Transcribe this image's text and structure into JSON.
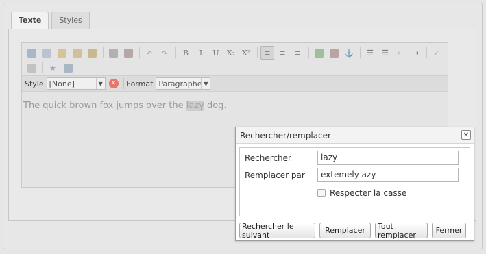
{
  "tabs": [
    {
      "label": "Texte",
      "active": true
    },
    {
      "label": "Styles",
      "active": false
    }
  ],
  "toolbar": {
    "row1": [
      {
        "name": "cut-icon",
        "glyph": "",
        "color": "#a8b8cc"
      },
      {
        "name": "copy-icon",
        "glyph": "",
        "color": "#b9c4d0"
      },
      {
        "name": "paste-icon",
        "glyph": "",
        "color": "#d7c39a"
      },
      {
        "name": "paste-text-icon",
        "glyph": "",
        "color": "#d2c09c"
      },
      {
        "name": "paste-word-icon",
        "glyph": "",
        "color": "#c9b98f"
      },
      {
        "sep": true
      },
      {
        "name": "link-icon",
        "glyph": "",
        "color": "#b1b1b1"
      },
      {
        "name": "unlink-icon",
        "glyph": "",
        "color": "#b7a6a6"
      },
      {
        "sep": true
      },
      {
        "name": "undo-icon",
        "glyph": "↶",
        "color": "#8fa3c1"
      },
      {
        "name": "redo-icon",
        "glyph": "↷",
        "color": "#8fa3c1"
      },
      {
        "sep": true
      },
      {
        "name": "bold-icon",
        "glyph": "B",
        "color": "#7c7c7c"
      },
      {
        "name": "italic-icon",
        "glyph": "I",
        "color": "#7c7c7c"
      },
      {
        "name": "underline-icon",
        "glyph": "U",
        "color": "#7c7c7c"
      },
      {
        "name": "subscript-icon",
        "glyph": "X₂",
        "color": "#7c7c7c"
      },
      {
        "name": "superscript-icon",
        "glyph": "X²",
        "color": "#7c7c7c"
      },
      {
        "sep": true
      },
      {
        "name": "align-left-icon",
        "glyph": "≡",
        "color": "#7c7c7c",
        "pressed": true
      },
      {
        "name": "align-center-icon",
        "glyph": "≡",
        "color": "#7c7c7c"
      },
      {
        "name": "align-right-icon",
        "glyph": "≡",
        "color": "#7c7c7c"
      },
      {
        "sep": true
      },
      {
        "name": "image-icon",
        "glyph": "",
        "color": "#9fbf9a"
      },
      {
        "name": "flash-icon",
        "glyph": "",
        "color": "#b9a3a3"
      },
      {
        "name": "anchor-icon",
        "glyph": "⚓",
        "color": "#7c7c7c"
      },
      {
        "sep": true
      },
      {
        "name": "bullet-list-icon",
        "glyph": "☰",
        "color": "#7c7c7c"
      },
      {
        "name": "numbered-list-icon",
        "glyph": "☰",
        "color": "#7c7c7c"
      },
      {
        "name": "outdent-icon",
        "glyph": "⇤",
        "color": "#7c7c7c"
      },
      {
        "name": "indent-icon",
        "glyph": "⇥",
        "color": "#7c7c7c"
      },
      {
        "sep": true
      },
      {
        "name": "spellcheck-icon",
        "glyph": "✓",
        "color": "#8fb3c8"
      }
    ],
    "row2": [
      {
        "name": "table-icon",
        "glyph": "",
        "color": "#c2c2c2"
      },
      {
        "sep": true
      },
      {
        "name": "star-icon",
        "glyph": "★",
        "color": "#8fa8c8"
      },
      {
        "name": "find-replace-icon",
        "glyph": "",
        "color": "#a9b6c6"
      }
    ]
  },
  "format_bar": {
    "style_label": "Style",
    "style_value": "[None]",
    "format_label": "Format",
    "format_value": "Paragraphe"
  },
  "content": {
    "before": "The quick brown fox jumps over the ",
    "highlighted": "lazy",
    "after": " dog."
  },
  "dialog": {
    "title": "Rechercher/remplacer",
    "close_glyph": "✕",
    "search_label": "Rechercher",
    "search_value": "lazy",
    "replace_label": "Remplacer par",
    "replace_value": "extemely azy",
    "match_case_label": "Respecter la casse",
    "buttons": {
      "find_next": "Rechercher le suivant",
      "replace": "Remplacer",
      "replace_all": "Tout remplacer",
      "close": "Fermer"
    }
  }
}
